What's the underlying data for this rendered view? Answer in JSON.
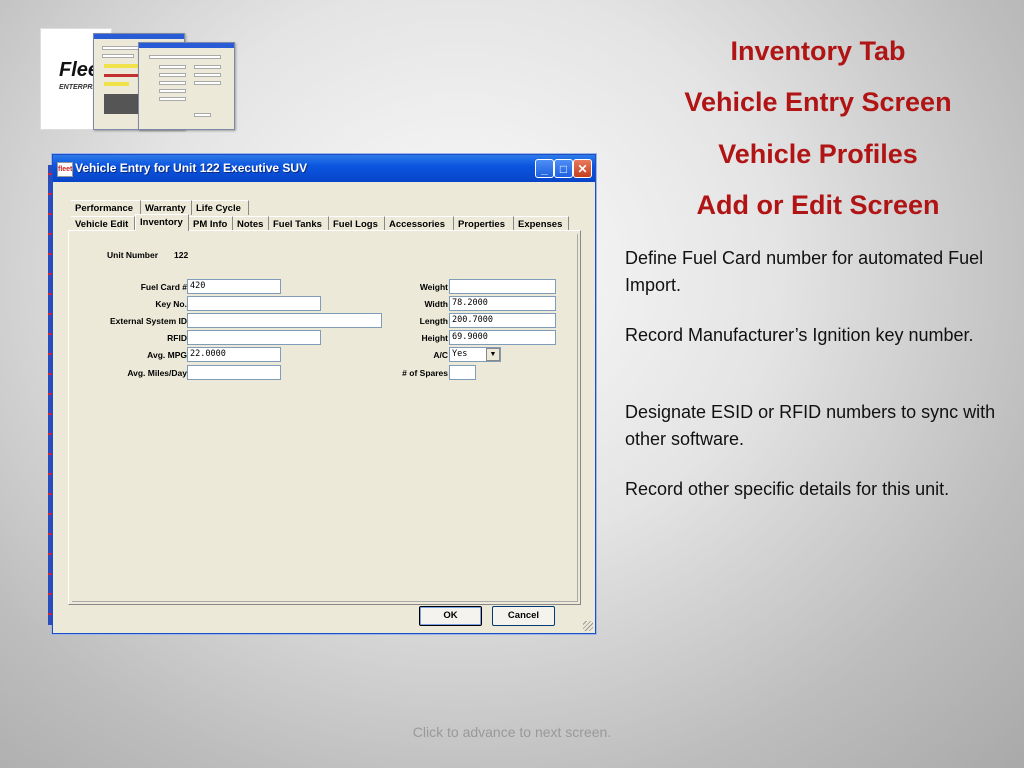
{
  "slide": {
    "headings": [
      "Inventory Tab",
      "Vehicle Entry Screen",
      "Vehicle Profiles",
      "Add or Edit Screen"
    ],
    "paragraphs": [
      "Define Fuel Card number for automated Fuel Import.",
      "Record Manufacturer’s Ignition key number.",
      "Designate  ESID or RFID numbers to sync with other software.",
      "Record other specific  details for this unit."
    ],
    "footer": "Click to advance to next screen.",
    "logo_text": "Flee",
    "logo_sub": "ENTERPRIS"
  },
  "window": {
    "title": "Vehicle Entry for Unit 122 Executive SUV",
    "icon_text": "fleet",
    "minimize": "_",
    "maximize": "□",
    "close": "✕",
    "tabs_row1": [
      "Performance",
      "Warranty",
      "Life Cycle"
    ],
    "tabs_row2": [
      "Vehicle Edit",
      "Inventory",
      "PM Info",
      "Notes",
      "Fuel Tanks",
      "Fuel Logs",
      "Accessories",
      "Properties",
      "Expenses"
    ],
    "active_tab": "Inventory",
    "unit_number_label": "Unit Number",
    "unit_number_value": "122",
    "left_fields": [
      {
        "label": "Fuel Card #",
        "value": "420"
      },
      {
        "label": "Key No.",
        "value": ""
      },
      {
        "label": "External System ID",
        "value": ""
      },
      {
        "label": "RFID",
        "value": ""
      },
      {
        "label": "Avg. MPG",
        "value": "22.0000"
      },
      {
        "label": "Avg. Miles/Day",
        "value": ""
      }
    ],
    "right_fields": [
      {
        "label": "Weight",
        "value": ""
      },
      {
        "label": "Width",
        "value": "78.2000"
      },
      {
        "label": "Length",
        "value": "200.7000"
      },
      {
        "label": "Height",
        "value": "69.9000"
      },
      {
        "label": "A/C",
        "value": "Yes"
      },
      {
        "label": "# of Spares",
        "value": ""
      }
    ],
    "ok_label": "OK",
    "cancel_label": "Cancel"
  }
}
